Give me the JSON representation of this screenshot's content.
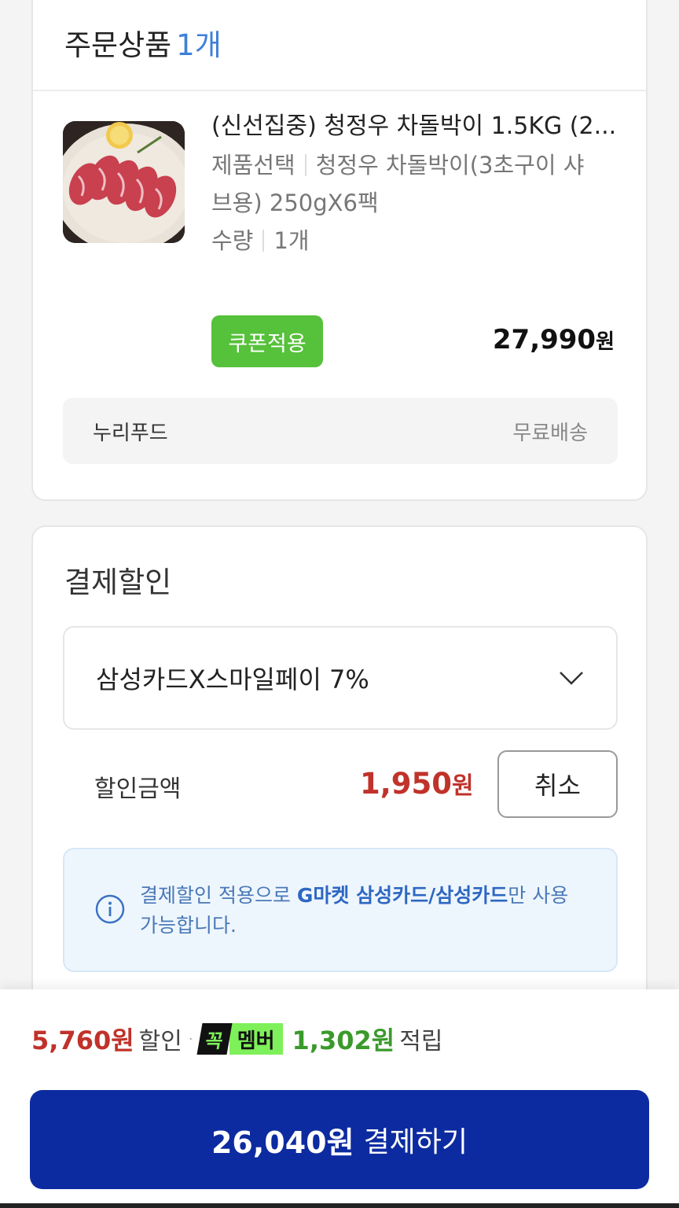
{
  "order": {
    "heading": "주문상품",
    "count": "1개",
    "product": {
      "title": "(신선집중) 청정우 차돌박이 1.5KG (2...",
      "option_label": "제품선택",
      "option_value_line1": "청정우 차돌박이(3초구이 샤",
      "option_value_line2": "브용) 250gX6팩",
      "qty_label": "수량",
      "qty_value": "1개",
      "coupon_label": "쿠폰적용",
      "price": "27,990",
      "price_unit": "원"
    },
    "seller": {
      "name": "누리푸드",
      "shipping": "무료배송"
    }
  },
  "payment_discount": {
    "title": "결제할인",
    "selected_card": "삼성카드X스마일페이 7%",
    "discount_label": "할인금액",
    "discount_amount": "1,950",
    "discount_unit": "원",
    "cancel_label": "취소",
    "notice": {
      "pre": "결제할인 적용으로 ",
      "highlight": "G마켓 삼성카드/삼성카드",
      "post": "만 사용 가능합니다."
    }
  },
  "bottom": {
    "total_discount": "5,760원",
    "discount_word": "할인",
    "separator": "·",
    "member_badge_black": "꼭",
    "member_badge_green": "멤버",
    "points": "1,302원",
    "points_word": "적립",
    "pay_amount": "26,040원",
    "pay_label": "결제하기"
  },
  "colors": {
    "accent_blue": "#3d7fd9",
    "coupon_green": "#56c13a",
    "discount_red": "#c0322a",
    "pay_button": "#0d2ba0",
    "point_green": "#3a9a2b"
  },
  "icons": [
    "chevron-down-icon",
    "info-icon"
  ]
}
